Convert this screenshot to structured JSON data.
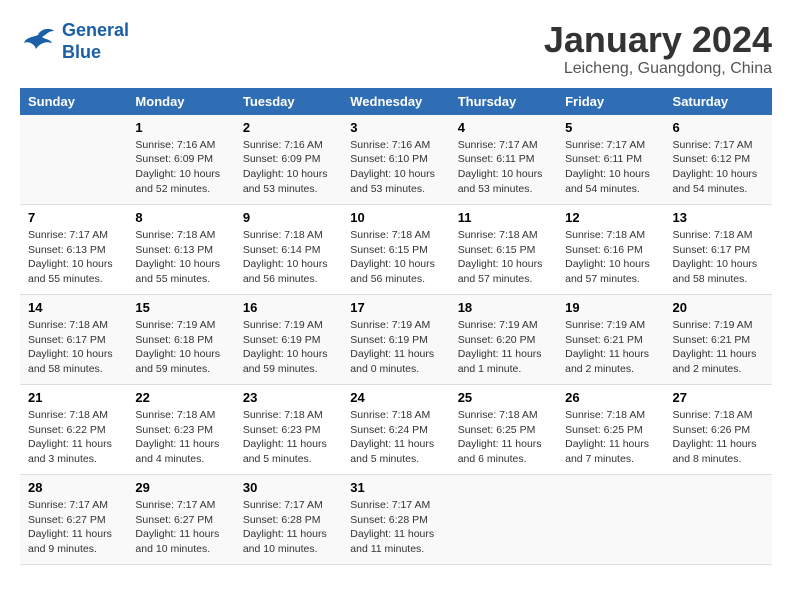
{
  "logo": {
    "line1": "General",
    "line2": "Blue"
  },
  "title": "January 2024",
  "subtitle": "Leicheng, Guangdong, China",
  "weekdays": [
    "Sunday",
    "Monday",
    "Tuesday",
    "Wednesday",
    "Thursday",
    "Friday",
    "Saturday"
  ],
  "weeks": [
    [
      {
        "day": "",
        "sunrise": "",
        "sunset": "",
        "daylight": ""
      },
      {
        "day": "1",
        "sunrise": "Sunrise: 7:16 AM",
        "sunset": "Sunset: 6:09 PM",
        "daylight": "Daylight: 10 hours and 52 minutes."
      },
      {
        "day": "2",
        "sunrise": "Sunrise: 7:16 AM",
        "sunset": "Sunset: 6:09 PM",
        "daylight": "Daylight: 10 hours and 53 minutes."
      },
      {
        "day": "3",
        "sunrise": "Sunrise: 7:16 AM",
        "sunset": "Sunset: 6:10 PM",
        "daylight": "Daylight: 10 hours and 53 minutes."
      },
      {
        "day": "4",
        "sunrise": "Sunrise: 7:17 AM",
        "sunset": "Sunset: 6:11 PM",
        "daylight": "Daylight: 10 hours and 53 minutes."
      },
      {
        "day": "5",
        "sunrise": "Sunrise: 7:17 AM",
        "sunset": "Sunset: 6:11 PM",
        "daylight": "Daylight: 10 hours and 54 minutes."
      },
      {
        "day": "6",
        "sunrise": "Sunrise: 7:17 AM",
        "sunset": "Sunset: 6:12 PM",
        "daylight": "Daylight: 10 hours and 54 minutes."
      }
    ],
    [
      {
        "day": "7",
        "sunrise": "Sunrise: 7:17 AM",
        "sunset": "Sunset: 6:13 PM",
        "daylight": "Daylight: 10 hours and 55 minutes."
      },
      {
        "day": "8",
        "sunrise": "Sunrise: 7:18 AM",
        "sunset": "Sunset: 6:13 PM",
        "daylight": "Daylight: 10 hours and 55 minutes."
      },
      {
        "day": "9",
        "sunrise": "Sunrise: 7:18 AM",
        "sunset": "Sunset: 6:14 PM",
        "daylight": "Daylight: 10 hours and 56 minutes."
      },
      {
        "day": "10",
        "sunrise": "Sunrise: 7:18 AM",
        "sunset": "Sunset: 6:15 PM",
        "daylight": "Daylight: 10 hours and 56 minutes."
      },
      {
        "day": "11",
        "sunrise": "Sunrise: 7:18 AM",
        "sunset": "Sunset: 6:15 PM",
        "daylight": "Daylight: 10 hours and 57 minutes."
      },
      {
        "day": "12",
        "sunrise": "Sunrise: 7:18 AM",
        "sunset": "Sunset: 6:16 PM",
        "daylight": "Daylight: 10 hours and 57 minutes."
      },
      {
        "day": "13",
        "sunrise": "Sunrise: 7:18 AM",
        "sunset": "Sunset: 6:17 PM",
        "daylight": "Daylight: 10 hours and 58 minutes."
      }
    ],
    [
      {
        "day": "14",
        "sunrise": "Sunrise: 7:18 AM",
        "sunset": "Sunset: 6:17 PM",
        "daylight": "Daylight: 10 hours and 58 minutes."
      },
      {
        "day": "15",
        "sunrise": "Sunrise: 7:19 AM",
        "sunset": "Sunset: 6:18 PM",
        "daylight": "Daylight: 10 hours and 59 minutes."
      },
      {
        "day": "16",
        "sunrise": "Sunrise: 7:19 AM",
        "sunset": "Sunset: 6:19 PM",
        "daylight": "Daylight: 10 hours and 59 minutes."
      },
      {
        "day": "17",
        "sunrise": "Sunrise: 7:19 AM",
        "sunset": "Sunset: 6:19 PM",
        "daylight": "Daylight: 11 hours and 0 minutes."
      },
      {
        "day": "18",
        "sunrise": "Sunrise: 7:19 AM",
        "sunset": "Sunset: 6:20 PM",
        "daylight": "Daylight: 11 hours and 1 minute."
      },
      {
        "day": "19",
        "sunrise": "Sunrise: 7:19 AM",
        "sunset": "Sunset: 6:21 PM",
        "daylight": "Daylight: 11 hours and 2 minutes."
      },
      {
        "day": "20",
        "sunrise": "Sunrise: 7:19 AM",
        "sunset": "Sunset: 6:21 PM",
        "daylight": "Daylight: 11 hours and 2 minutes."
      }
    ],
    [
      {
        "day": "21",
        "sunrise": "Sunrise: 7:18 AM",
        "sunset": "Sunset: 6:22 PM",
        "daylight": "Daylight: 11 hours and 3 minutes."
      },
      {
        "day": "22",
        "sunrise": "Sunrise: 7:18 AM",
        "sunset": "Sunset: 6:23 PM",
        "daylight": "Daylight: 11 hours and 4 minutes."
      },
      {
        "day": "23",
        "sunrise": "Sunrise: 7:18 AM",
        "sunset": "Sunset: 6:23 PM",
        "daylight": "Daylight: 11 hours and 5 minutes."
      },
      {
        "day": "24",
        "sunrise": "Sunrise: 7:18 AM",
        "sunset": "Sunset: 6:24 PM",
        "daylight": "Daylight: 11 hours and 5 minutes."
      },
      {
        "day": "25",
        "sunrise": "Sunrise: 7:18 AM",
        "sunset": "Sunset: 6:25 PM",
        "daylight": "Daylight: 11 hours and 6 minutes."
      },
      {
        "day": "26",
        "sunrise": "Sunrise: 7:18 AM",
        "sunset": "Sunset: 6:25 PM",
        "daylight": "Daylight: 11 hours and 7 minutes."
      },
      {
        "day": "27",
        "sunrise": "Sunrise: 7:18 AM",
        "sunset": "Sunset: 6:26 PM",
        "daylight": "Daylight: 11 hours and 8 minutes."
      }
    ],
    [
      {
        "day": "28",
        "sunrise": "Sunrise: 7:17 AM",
        "sunset": "Sunset: 6:27 PM",
        "daylight": "Daylight: 11 hours and 9 minutes."
      },
      {
        "day": "29",
        "sunrise": "Sunrise: 7:17 AM",
        "sunset": "Sunset: 6:27 PM",
        "daylight": "Daylight: 11 hours and 10 minutes."
      },
      {
        "day": "30",
        "sunrise": "Sunrise: 7:17 AM",
        "sunset": "Sunset: 6:28 PM",
        "daylight": "Daylight: 11 hours and 10 minutes."
      },
      {
        "day": "31",
        "sunrise": "Sunrise: 7:17 AM",
        "sunset": "Sunset: 6:28 PM",
        "daylight": "Daylight: 11 hours and 11 minutes."
      },
      {
        "day": "",
        "sunrise": "",
        "sunset": "",
        "daylight": ""
      },
      {
        "day": "",
        "sunrise": "",
        "sunset": "",
        "daylight": ""
      },
      {
        "day": "",
        "sunrise": "",
        "sunset": "",
        "daylight": ""
      }
    ]
  ]
}
